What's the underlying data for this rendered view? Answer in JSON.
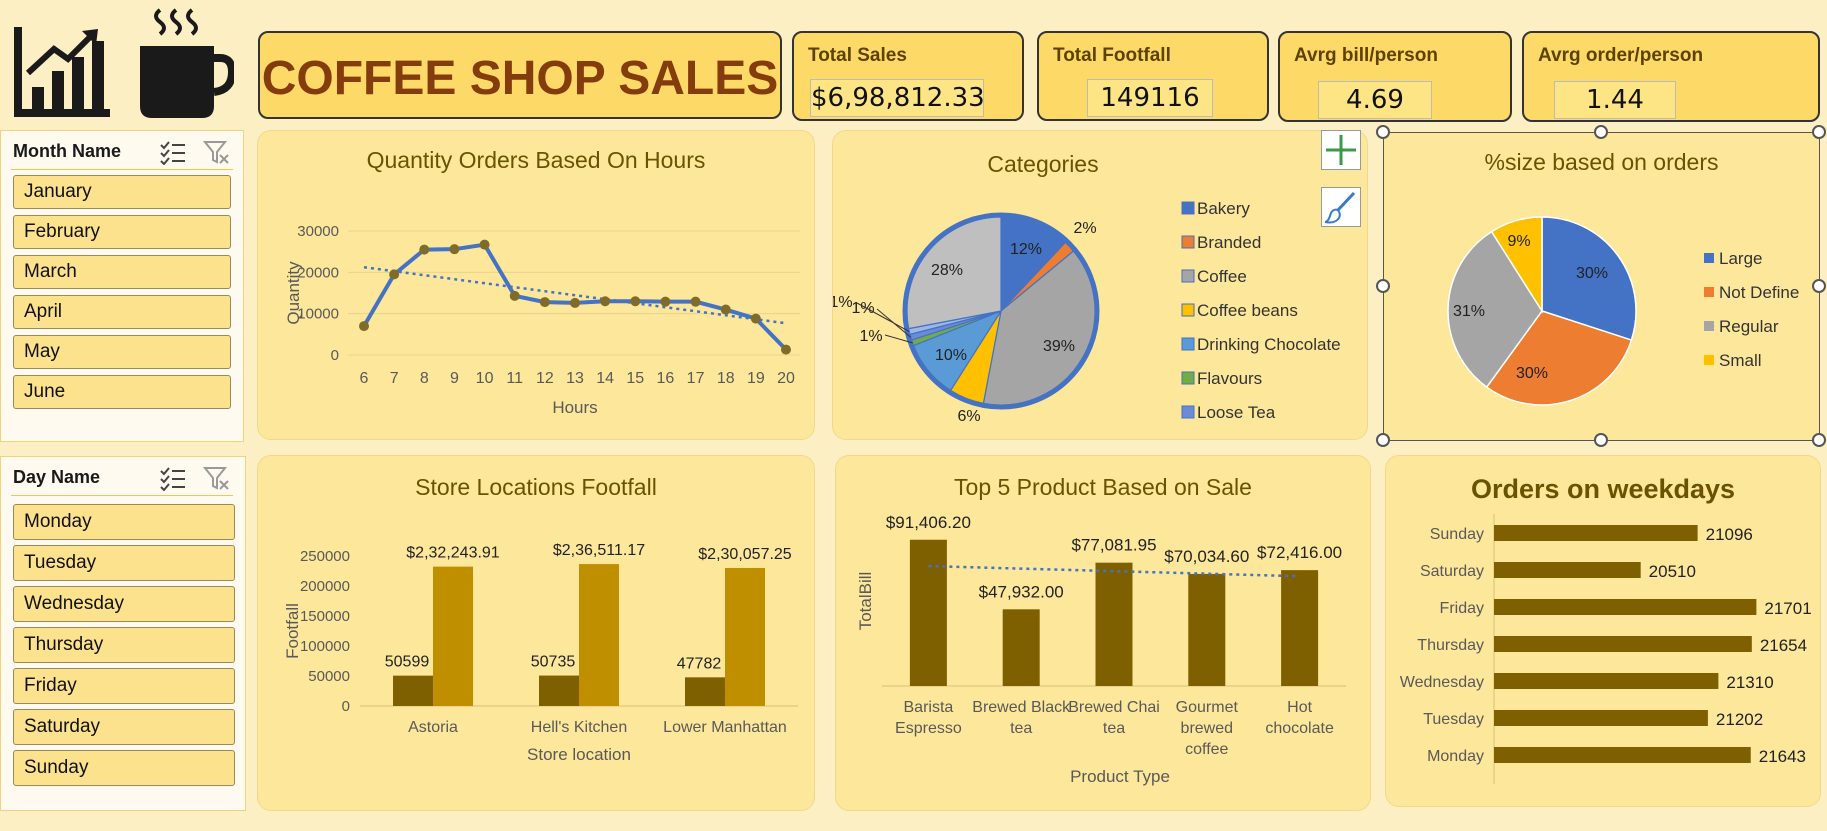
{
  "header": {
    "title": "COFFEE SHOP SALES"
  },
  "kpis": [
    {
      "label": "Total Sales",
      "value": "$6,98,812.33"
    },
    {
      "label": "Total Footfall",
      "value": "149116"
    },
    {
      "label": "Avrg bill/person",
      "value": "4.69"
    },
    {
      "label": "Avrg order/person",
      "value": "1.44"
    }
  ],
  "slicers": {
    "month": {
      "title": "Month Name",
      "items": [
        "January",
        "February",
        "March",
        "April",
        "May",
        "June"
      ]
    },
    "day": {
      "title": "Day Name",
      "items": [
        "Monday",
        "Tuesday",
        "Wednesday",
        "Thursday",
        "Friday",
        "Saturday",
        "Sunday"
      ]
    }
  },
  "icons": [
    "bar-chart-growth-icon",
    "coffee-cup-icon",
    "multi-select-icon",
    "clear-filter-icon",
    "chart-elements-plus-icon",
    "chart-styles-brush-icon"
  ],
  "colors": {
    "gold": "#bf8f00",
    "brown": "#7f6000",
    "blue": "#4472c4",
    "orange": "#ed7d31",
    "gray": "#a5a5a5",
    "yellow": "#ffc000",
    "grayLight": "#bfbfbf"
  },
  "chart_data": [
    {
      "id": "hours",
      "type": "line",
      "title": "Quantity Orders Based On Hours",
      "xlabel": "Hours",
      "ylabel": "Quantity",
      "ylim": [
        0,
        30000
      ],
      "yticks": [
        "0",
        "10000",
        "20000",
        "30000"
      ],
      "x": [
        "6",
        "7",
        "8",
        "9",
        "10",
        "11",
        "12",
        "13",
        "14",
        "15",
        "16",
        "17",
        "18",
        "19",
        "20"
      ],
      "values": [
        7000,
        19500,
        25500,
        25600,
        26700,
        14300,
        12800,
        12600,
        13000,
        13000,
        12900,
        12900,
        11000,
        8800,
        1300
      ],
      "trendline": true,
      "grid": true
    },
    {
      "id": "categories",
      "type": "pie",
      "title": "Categories",
      "legend_position": "right",
      "slices": [
        {
          "name": "Bakery",
          "value": 12,
          "label": "12%",
          "color": "#4472c4"
        },
        {
          "name": "Branded",
          "value": 2,
          "label": "2%",
          "color": "#ed7d31"
        },
        {
          "name": "Coffee",
          "value": 39,
          "label": "39%",
          "color": "#a5a5a5"
        },
        {
          "name": "Coffee beans",
          "value": 6,
          "label": "6%",
          "color": "#ffc000"
        },
        {
          "name": "Drinking Chocolate",
          "value": 10,
          "label": "10%",
          "color": "#5b9bd5"
        },
        {
          "name": "Flavours",
          "value": 1,
          "label": "1%",
          "color": "#70ad47"
        },
        {
          "name": "Loose Tea",
          "value": 1,
          "label": "1%",
          "color": "#6c8ad8"
        },
        {
          "name": "",
          "value": 1,
          "label": "1%",
          "color": "#9eb6e6"
        },
        {
          "name": "",
          "value": 28,
          "label": "28%",
          "color": "#bfbfbf"
        }
      ]
    },
    {
      "id": "sizes",
      "type": "pie",
      "title": "%size based on orders",
      "legend_position": "right",
      "slices": [
        {
          "name": "Large",
          "value": 30,
          "label": "30%",
          "color": "#4472c4"
        },
        {
          "name": "Not Define",
          "value": 30,
          "label": "30%",
          "color": "#ed7d31"
        },
        {
          "name": "Regular",
          "value": 31,
          "label": "31%",
          "color": "#a5a5a5"
        },
        {
          "name": "Small",
          "value": 9,
          "label": "9%",
          "color": "#ffc000"
        }
      ]
    },
    {
      "id": "stores",
      "type": "bar",
      "title": "Store Locations Footfall",
      "xlabel": "Store location",
      "ylabel": "Footfall",
      "ylim": [
        0,
        250000
      ],
      "yticks": [
        "0",
        "50000",
        "100000",
        "150000",
        "200000",
        "250000"
      ],
      "categories": [
        "Astoria",
        "Hell's Kitchen",
        "Lower Manhattan"
      ],
      "series": [
        {
          "values": [
            50599,
            50735,
            47782
          ],
          "labels": [
            "50599",
            "50735",
            "47782"
          ],
          "color": "#7f6000"
        },
        {
          "values": [
            232243.91,
            236511.17,
            230057.25
          ],
          "labels": [
            "$2,32,243.91",
            "$2,36,511.17",
            "$2,30,057.25"
          ],
          "color": "#bf8f00"
        }
      ]
    },
    {
      "id": "products",
      "type": "bar",
      "title": "Top 5 Product Based on Sale",
      "xlabel": "Product Type",
      "ylabel": "TotalBill",
      "categories": [
        [
          "Barista",
          "Espresso"
        ],
        [
          "Brewed Black",
          "tea"
        ],
        [
          "Brewed Chai",
          "tea"
        ],
        [
          "Gourmet",
          "brewed",
          "coffee"
        ],
        [
          "Hot",
          "chocolate"
        ]
      ],
      "values": [
        91406.2,
        47932.0,
        77081.95,
        70034.6,
        72416.0
      ],
      "labels": [
        "$91,406.20",
        "$47,932.00",
        "$77,081.95",
        "$70,034.60",
        "$72,416.00"
      ],
      "trendline": true
    },
    {
      "id": "weekdays",
      "type": "bar",
      "orientation": "horizontal",
      "title": "Orders on weekdays",
      "categories": [
        "Sunday",
        "Saturday",
        "Friday",
        "Thursday",
        "Wednesday",
        "Tuesday",
        "Monday"
      ],
      "values": [
        21096,
        20510,
        21701,
        21654,
        21310,
        21202,
        21643
      ],
      "labels": [
        "21096",
        "20510",
        "21701",
        "21654",
        "21310",
        "21202",
        "21643"
      ]
    }
  ]
}
